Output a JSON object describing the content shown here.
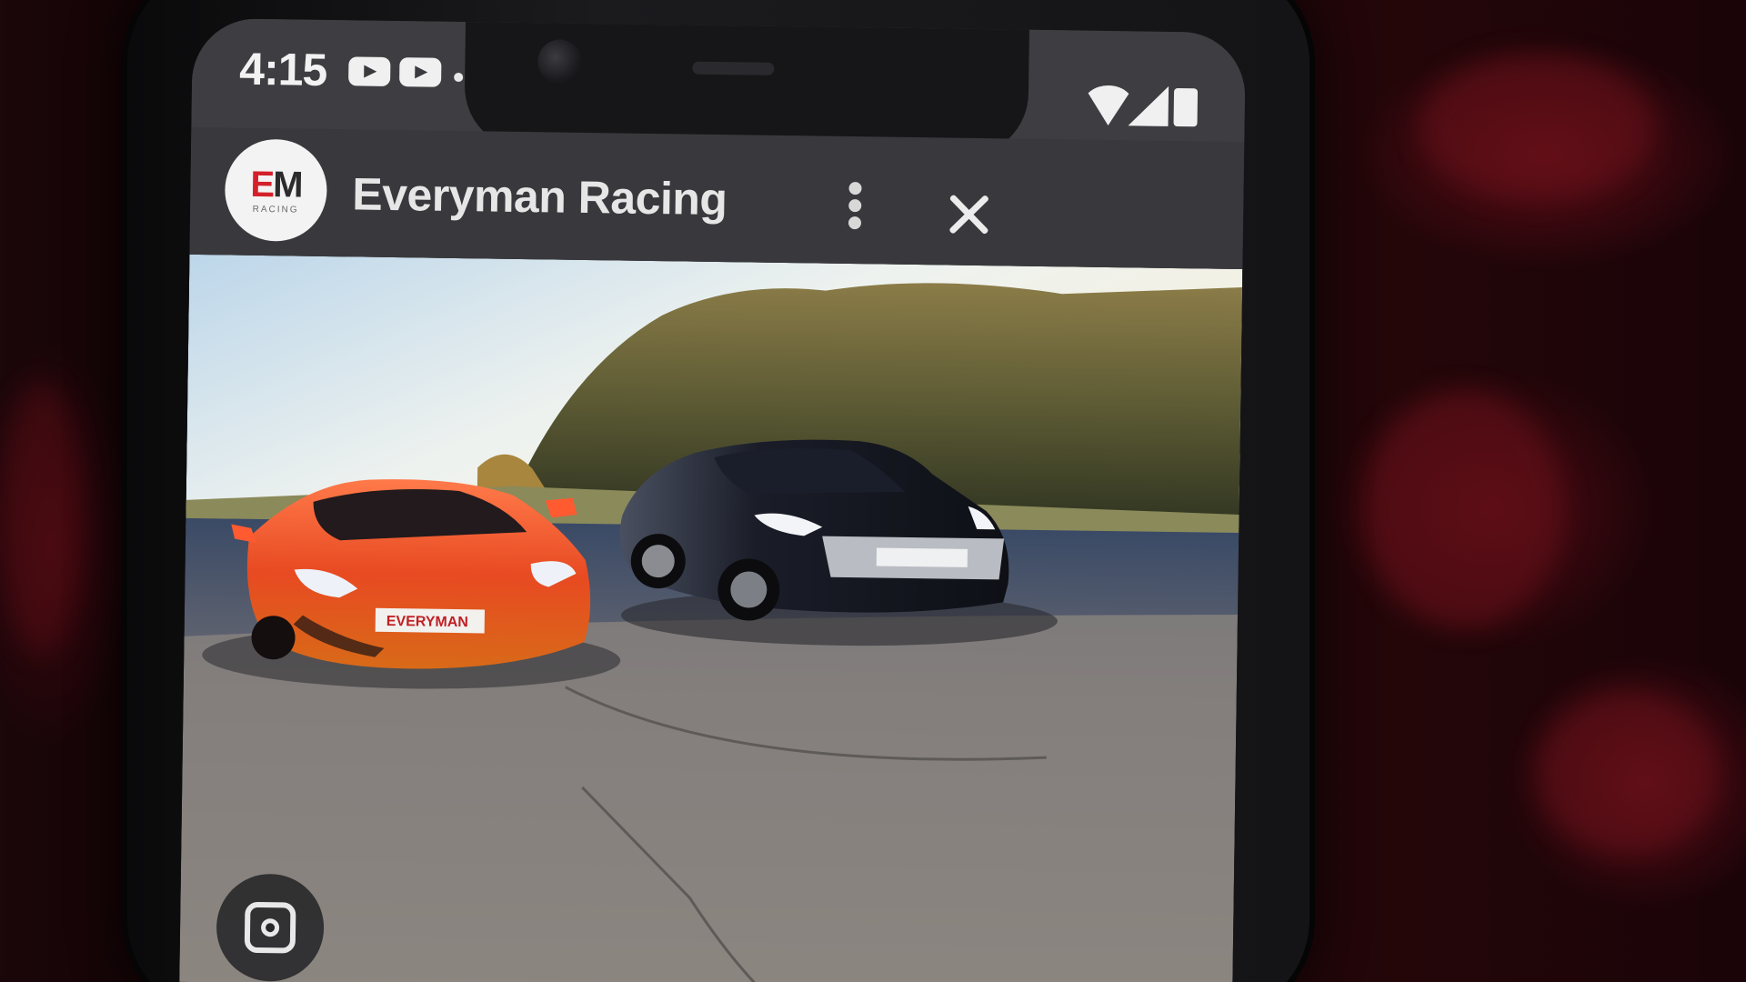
{
  "status_bar": {
    "time": "4:15",
    "icons": [
      "youtube-icon",
      "youtube-icon",
      "dot-icon",
      "wifi-icon",
      "signal-icon",
      "battery-icon"
    ]
  },
  "header": {
    "channel_name": "Everyman Racing",
    "logo": {
      "mark_e": "E",
      "mark_m": "M",
      "sub": "RACING"
    },
    "menu_icon": "more-vert-icon",
    "close_icon": "close-icon"
  },
  "photo": {
    "plate_text": "EVERYMAN",
    "subjects": [
      "orange-supercar",
      "black-sports-car"
    ]
  },
  "overlay": {
    "lens_icon": "visual-search-icon"
  },
  "colors": {
    "header_bg": "#39393d",
    "accent_red": "#d4202a",
    "orange_car": "#e8521e",
    "black_car": "#15171f"
  }
}
